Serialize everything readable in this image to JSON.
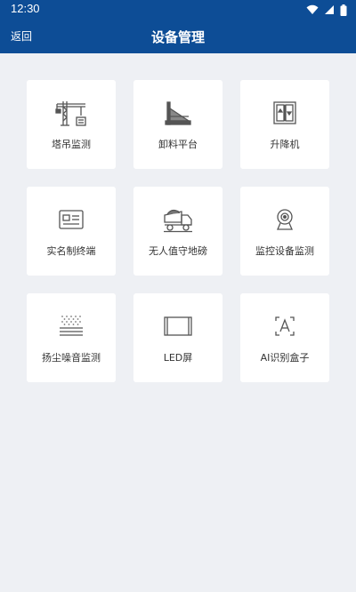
{
  "status": {
    "time": "12:30"
  },
  "header": {
    "back_label": "返回",
    "title": "设备管理"
  },
  "tiles": [
    {
      "label": "塔吊监测",
      "icon": "tower-crane-icon"
    },
    {
      "label": "卸料平台",
      "icon": "unloading-platform-icon"
    },
    {
      "label": "升降机",
      "icon": "elevator-icon"
    },
    {
      "label": "实名制终端",
      "icon": "id-card-terminal-icon"
    },
    {
      "label": "无人值守地磅",
      "icon": "dump-truck-icon"
    },
    {
      "label": "监控设备监测",
      "icon": "webcam-icon"
    },
    {
      "label": "扬尘噪音监测",
      "icon": "dust-noise-icon"
    },
    {
      "label": "LED屏",
      "icon": "led-screen-icon"
    },
    {
      "label": "AI识别盒子",
      "icon": "ai-recognition-icon"
    }
  ],
  "colors": {
    "primary": "#0d4d96",
    "background": "#eef0f4"
  }
}
